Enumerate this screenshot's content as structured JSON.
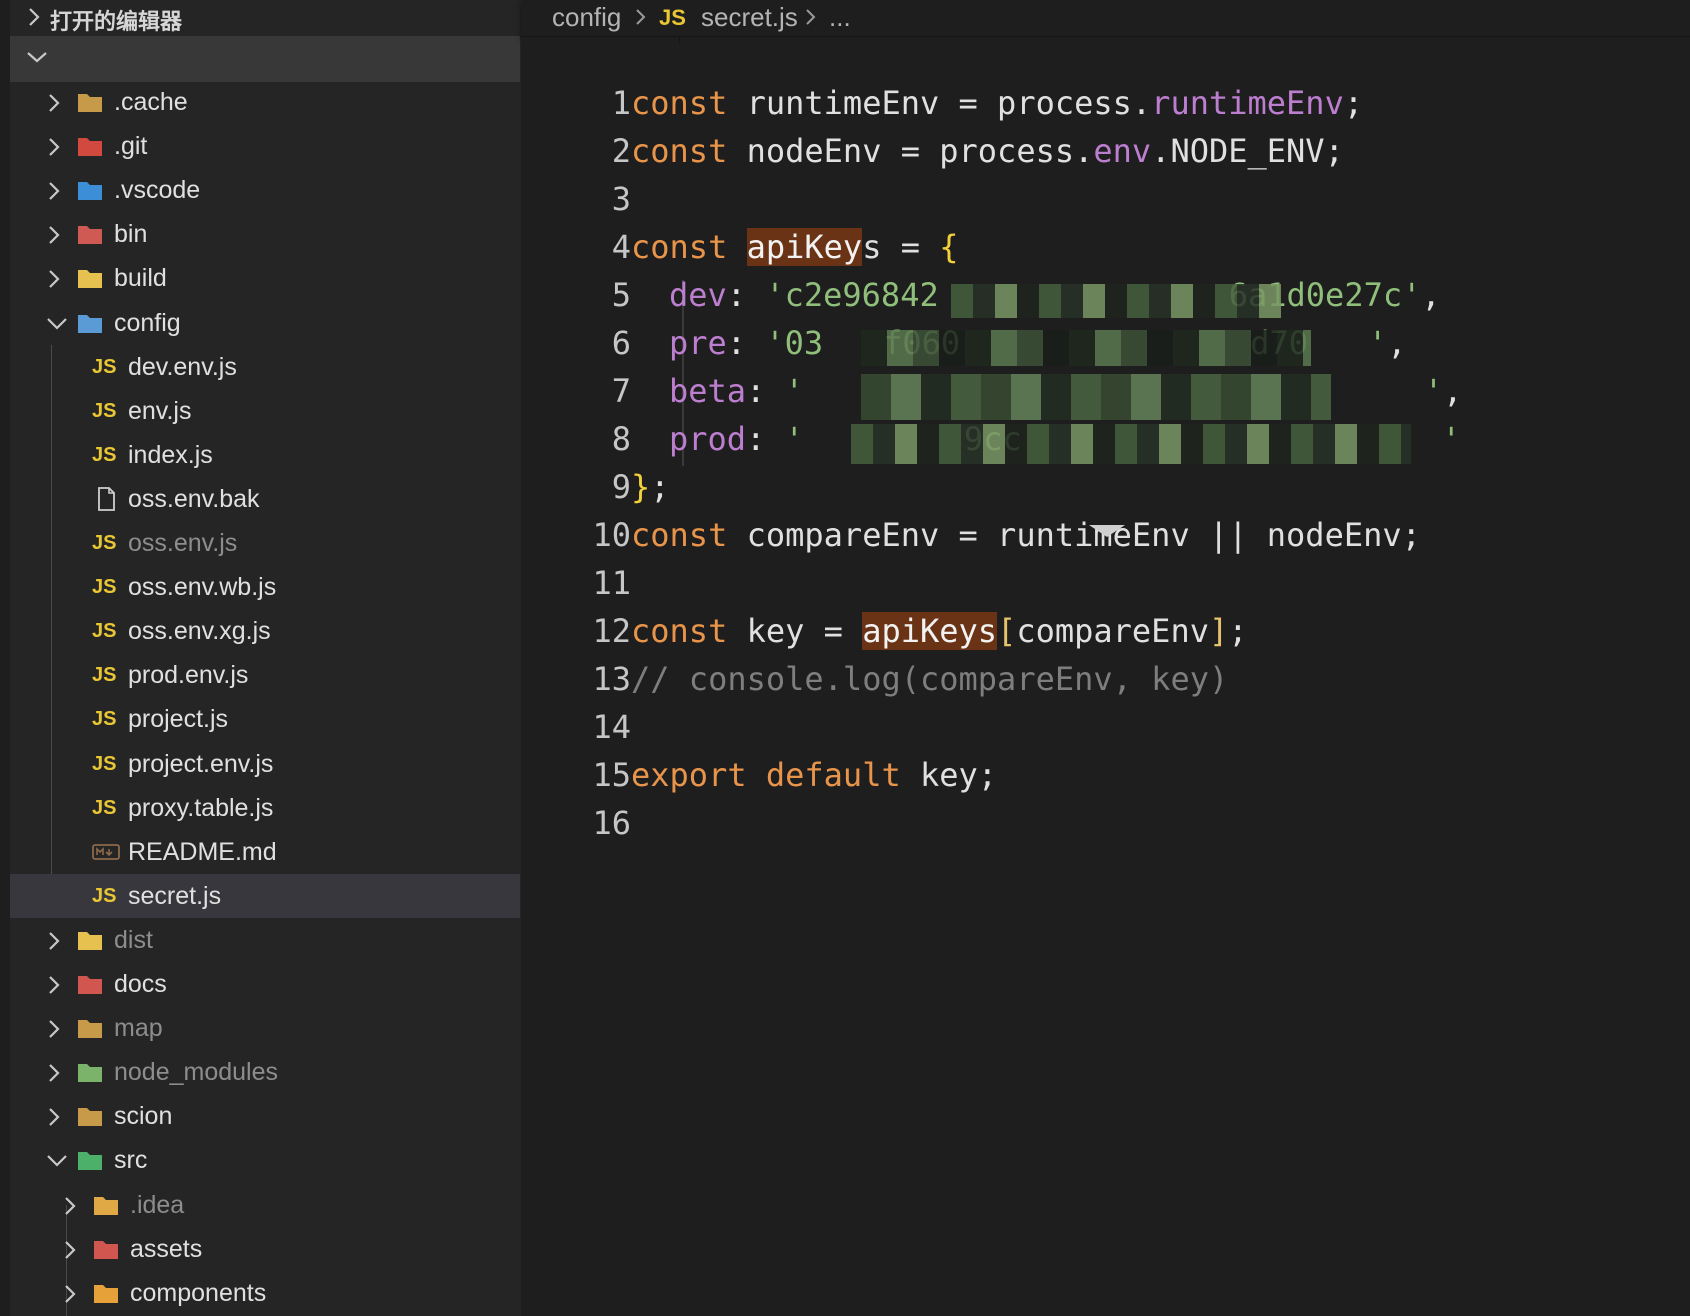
{
  "sidebar": {
    "open_editors_title": "打开的编辑器",
    "tree": [
      {
        "label": ".cache",
        "type": "folder",
        "icon": "folder-icon",
        "expanded": false,
        "dim": false
      },
      {
        "label": ".git",
        "type": "folder",
        "icon": "git-folder-icon",
        "expanded": false,
        "dim": false
      },
      {
        "label": ".vscode",
        "type": "folder",
        "icon": "vscode-folder-icon",
        "expanded": false,
        "dim": false
      },
      {
        "label": "bin",
        "type": "folder",
        "icon": "bin-folder-icon",
        "expanded": false,
        "dim": false
      },
      {
        "label": "build",
        "type": "folder",
        "icon": "build-folder-icon",
        "expanded": false,
        "dim": false
      },
      {
        "label": "config",
        "type": "folder",
        "icon": "config-folder-icon",
        "expanded": true,
        "dim": false
      },
      {
        "label": "dev.env.js",
        "type": "js",
        "icon": "js-file-icon",
        "dim": false
      },
      {
        "label": "env.js",
        "type": "js",
        "icon": "js-file-icon",
        "dim": false
      },
      {
        "label": "index.js",
        "type": "js",
        "icon": "js-file-icon",
        "dim": false
      },
      {
        "label": "oss.env.bak",
        "type": "file",
        "icon": "file-icon",
        "dim": false
      },
      {
        "label": "oss.env.js",
        "type": "js",
        "icon": "js-file-icon",
        "dim": true
      },
      {
        "label": "oss.env.wb.js",
        "type": "js",
        "icon": "js-file-icon",
        "dim": false
      },
      {
        "label": "oss.env.xg.js",
        "type": "js",
        "icon": "js-file-icon",
        "dim": false
      },
      {
        "label": "prod.env.js",
        "type": "js",
        "icon": "js-file-icon",
        "dim": false
      },
      {
        "label": "project.js",
        "type": "js",
        "icon": "js-file-icon",
        "dim": false
      },
      {
        "label": "project.env.js",
        "type": "js",
        "icon": "js-file-icon",
        "dim": false
      },
      {
        "label": "proxy.table.js",
        "type": "js",
        "icon": "js-file-icon",
        "dim": false
      },
      {
        "label": "README.md",
        "type": "md",
        "icon": "markdown-file-icon",
        "dim": false
      },
      {
        "label": "secret.js",
        "type": "js",
        "icon": "js-file-icon",
        "dim": false,
        "selected": true
      },
      {
        "label": "dist",
        "type": "folder",
        "icon": "dist-folder-icon",
        "expanded": false,
        "dim": true
      },
      {
        "label": "docs",
        "type": "folder",
        "icon": "docs-folder-icon",
        "expanded": false,
        "dim": false
      },
      {
        "label": "map",
        "type": "folder",
        "icon": "folder-icon",
        "expanded": false,
        "dim": true
      },
      {
        "label": "node_modules",
        "type": "folder",
        "icon": "node-modules-folder-icon",
        "expanded": false,
        "dim": true
      },
      {
        "label": "scion",
        "type": "folder",
        "icon": "folder-icon",
        "expanded": false,
        "dim": false
      },
      {
        "label": "src",
        "type": "folder",
        "icon": "src-folder-icon",
        "expanded": true,
        "dim": false
      },
      {
        "label": ".idea",
        "type": "folder",
        "icon": "idea-folder-icon",
        "expanded": false,
        "dim": true
      },
      {
        "label": "assets",
        "type": "folder",
        "icon": "assets-folder-icon",
        "expanded": false,
        "dim": false
      },
      {
        "label": "components",
        "type": "folder",
        "icon": "components-folder-icon",
        "expanded": false,
        "dim": false
      }
    ]
  },
  "breadcrumb": {
    "folder": "config",
    "js_badge": "JS",
    "file": "secret.js",
    "more": "..."
  },
  "editor": {
    "line_numbers": [
      "1",
      "2",
      "3",
      "4",
      "5",
      "6",
      "7",
      "8",
      "9",
      "10",
      "11",
      "12",
      "13",
      "14",
      "15",
      "16"
    ],
    "code": {
      "l1": {
        "kw": "const",
        "a": " runtimeEnv = process.",
        "p": "runtimeEnv",
        "b": ";"
      },
      "l2": {
        "kw": "const",
        "a": " nodeEnv = process.",
        "p": "env",
        "b": ".NODE_ENV;"
      },
      "l4": {
        "kw": "const",
        "sp": " ",
        "hl": "apiKey",
        "a": "s = ",
        "brace": "{"
      },
      "l5": {
        "p": "dev",
        "colon": ": ",
        "s": "'c2e96842",
        "s2": "6a1d0e27c'",
        "comma": ","
      },
      "l6": {
        "p": "pre",
        "colon": ": ",
        "s": "'03",
        "s2": "f060",
        "s3": "d70",
        "s4": "'",
        "comma": ","
      },
      "l7": {
        "p": "beta",
        "colon": ": ",
        "s": "'",
        "s2": "'",
        "comma": ","
      },
      "l8": {
        "p": "prod",
        "colon": ": ",
        "s": "'",
        "s2": "9cc",
        "s3": "'"
      },
      "l9": {
        "brace": "}",
        "b": ";"
      },
      "l10": {
        "kw": "const",
        "a": " compareEnv = runtimeEnv || nodeEnv;"
      },
      "l12": {
        "kw": "const",
        "a": " key = ",
        "hl": "apiKeys",
        "lb": "[",
        "mid": "compareEnv",
        "rb": "]",
        "b": ";"
      },
      "l13": {
        "c": "// console.log(compareEnv, key)"
      },
      "l15": {
        "kw": "export",
        "sp": " ",
        "kw2": "default",
        "a": " key;"
      }
    }
  },
  "colors": {
    "keyword": "#e8944a",
    "property": "#bc7ecf",
    "string": "#8fbf7a",
    "comment": "#7e7e7e",
    "js_badge": "#e8c634",
    "highlight": "#6b3315"
  }
}
